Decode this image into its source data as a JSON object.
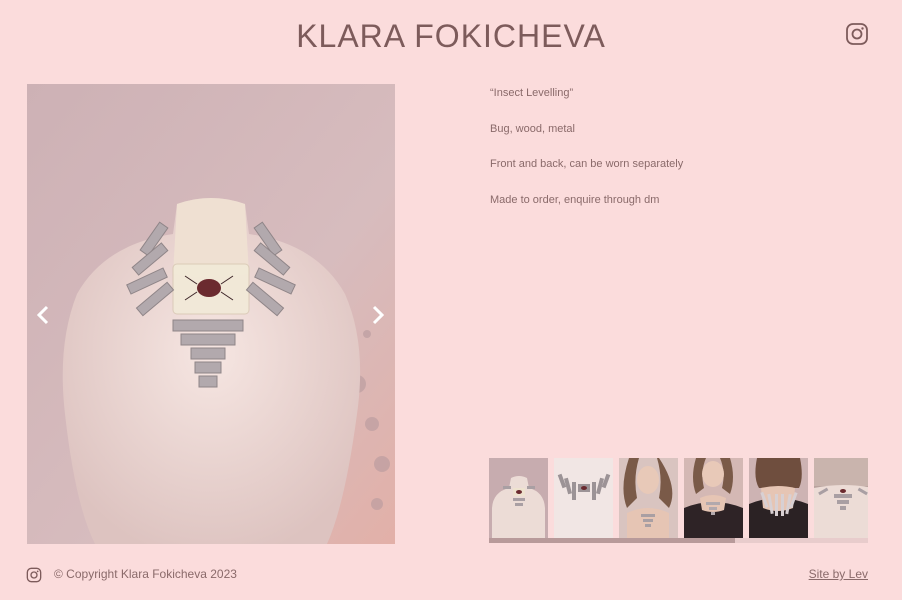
{
  "header": {
    "title": "KLARA FOKICHEVA",
    "instagram_icon": "instagram-icon"
  },
  "product": {
    "lines": [
      "“Insect Levelling”",
      "Bug, wood, metal",
      "Front and back, can be worn separately",
      "Made to order, enquire through dm"
    ]
  },
  "gallery": {
    "prev_icon": "chevron-left-icon",
    "next_icon": "chevron-right-icon",
    "thumbnail_count": 6
  },
  "footer": {
    "instagram_icon": "instagram-icon",
    "copyright": "© Copyright Klara Fokicheva 2023",
    "credit": "Site by Lev"
  },
  "colors": {
    "background": "#fbdcdc",
    "text": "#7d5b5b"
  }
}
